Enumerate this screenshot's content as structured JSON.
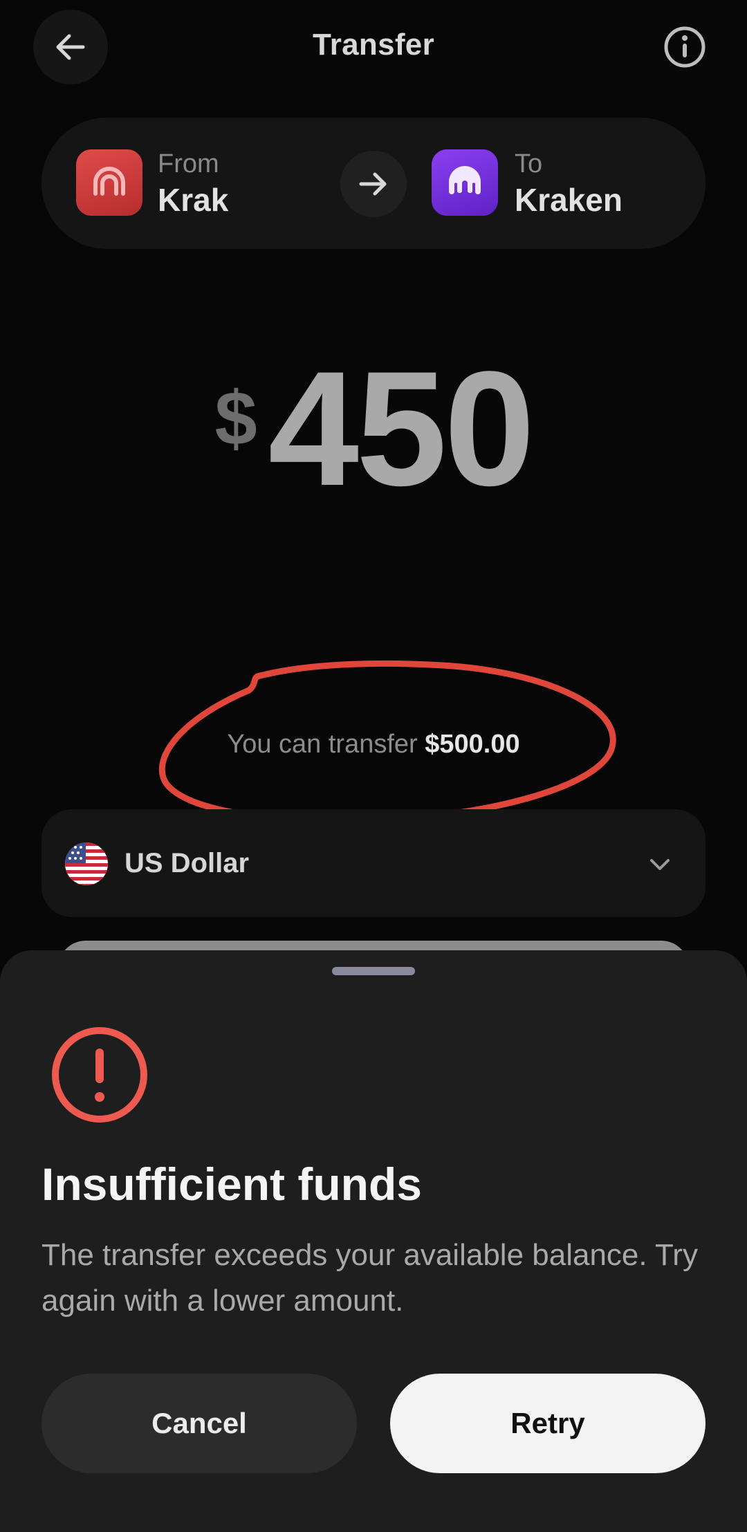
{
  "header": {
    "title": "Transfer",
    "back_icon": "arrow-left-icon",
    "info_icon": "info-icon"
  },
  "route": {
    "from_label": "From",
    "from_name": "Krak",
    "to_label": "To",
    "to_name": "Kraken",
    "from_color": "#d93c3c",
    "to_color": "#7a33e6"
  },
  "amount": {
    "currency_sign": "$",
    "value": "450"
  },
  "available": {
    "prefix": "You can transfer",
    "value": "$500.00"
  },
  "currency": {
    "selected": "US Dollar",
    "flag_icon": "us-flag-icon"
  },
  "sheet": {
    "title": "Insufficient funds",
    "body": "The transfer exceeds your available balance. Try again with a lower amount.",
    "cancel_label": "Cancel",
    "retry_label": "Retry",
    "alert_color": "#ee5a4f"
  },
  "annotation_color": "#e0463a"
}
